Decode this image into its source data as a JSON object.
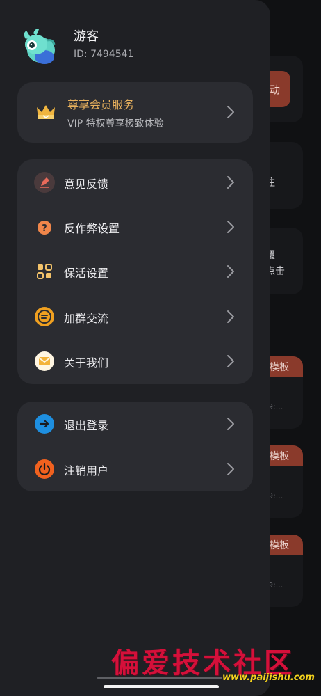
{
  "background_app": {
    "button_char": "动",
    "partial_text_1": "注",
    "partial_text_2": "覆",
    "partial_text_3": "点击",
    "template_label": "模板",
    "template_time": "9:..."
  },
  "user": {
    "name": "游客",
    "id_text": "ID: 7494541"
  },
  "vip": {
    "title": "尊享会员服务",
    "subtitle": "VIP 特权尊享极致体验"
  },
  "menu_group_1": [
    {
      "label": "意见反馈",
      "icon": "feedback-pen-icon"
    },
    {
      "label": "反作弊设置",
      "icon": "anti-cheat-question-icon"
    },
    {
      "label": "保活设置",
      "icon": "keep-alive-grid-icon"
    },
    {
      "label": "加群交流",
      "icon": "group-chat-icon"
    },
    {
      "label": "关于我们",
      "icon": "mail-envelope-icon"
    }
  ],
  "menu_group_2": [
    {
      "label": "退出登录",
      "icon": "logout-arrow-icon"
    },
    {
      "label": "注销用户",
      "icon": "power-icon"
    }
  ],
  "watermark": {
    "cn": "偏爱技术社区",
    "url": "www.paijishu.com"
  },
  "colors": {
    "drawer_bg": "#1f2024",
    "card_bg": "#2b2c31",
    "vip_gold": "#e8b15d",
    "accent_red": "#8a3a2b",
    "logout_blue": "#1e8fe0",
    "power_orange": "#f0611f"
  }
}
